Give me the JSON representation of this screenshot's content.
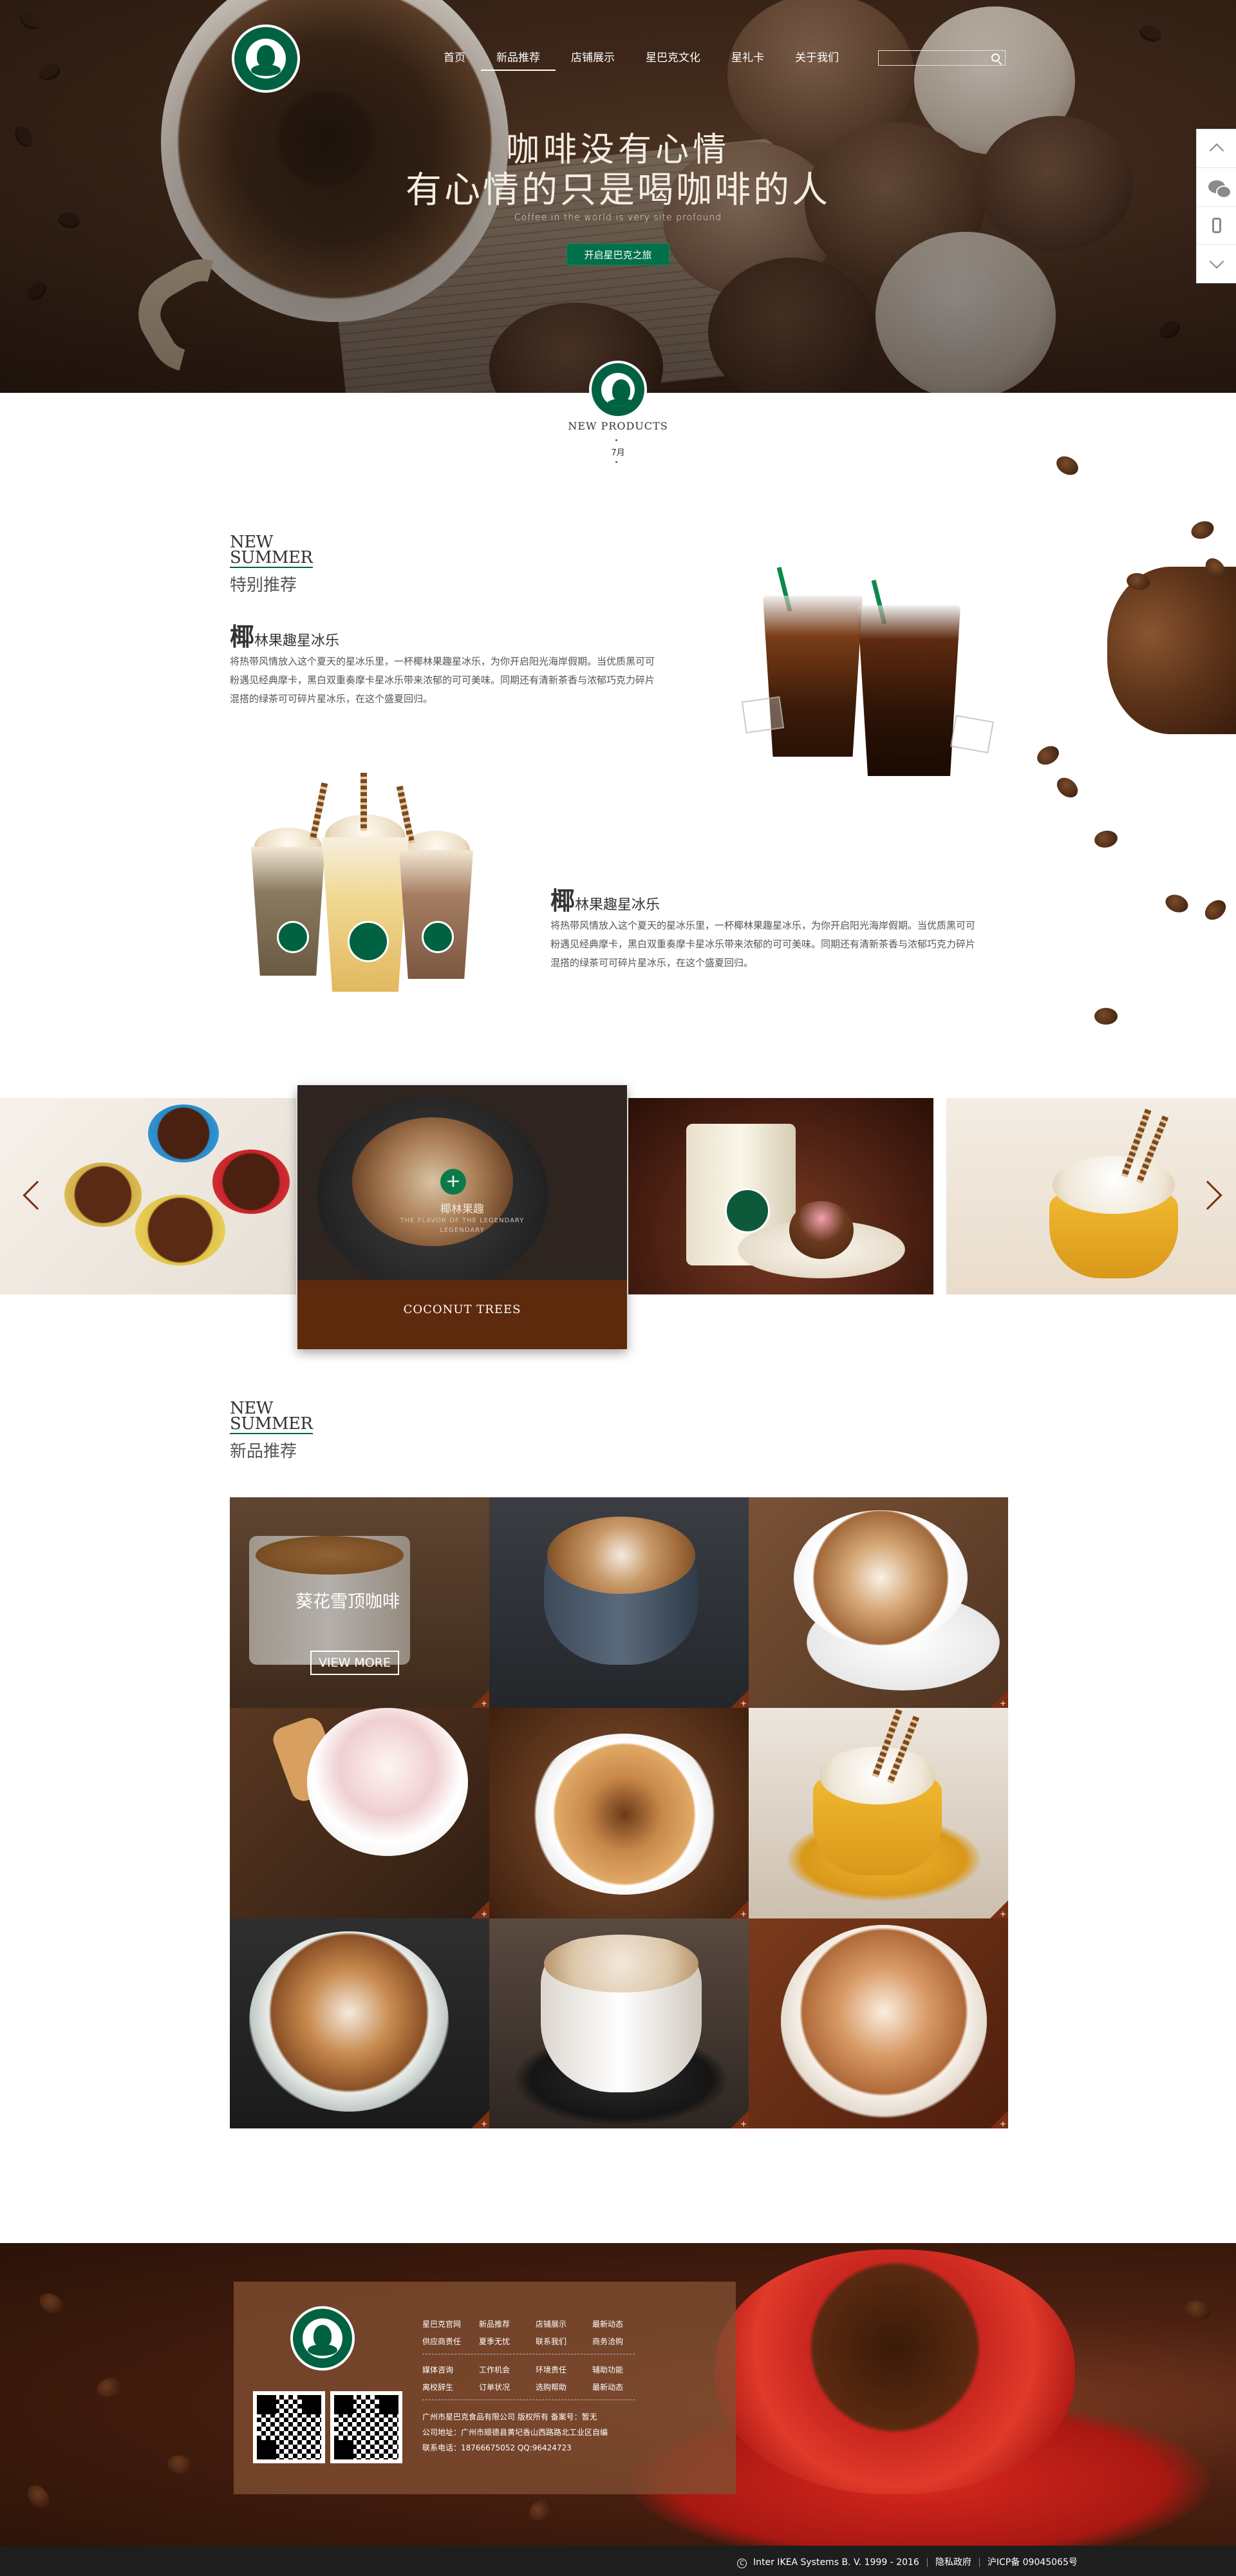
{
  "nav": {
    "items": [
      {
        "label": "首页",
        "active": false
      },
      {
        "label": "新品推荐",
        "active": true
      },
      {
        "label": "店铺展示",
        "active": false
      },
      {
        "label": "星巴克文化",
        "active": false
      },
      {
        "label": "星礼卡",
        "active": false
      },
      {
        "label": "关于我们",
        "active": false
      }
    ],
    "search_placeholder": ""
  },
  "hero": {
    "line1": "咖啡没有心情",
    "line2": "有心情的只是喝咖啡的人",
    "subtitle": "Coffee in the world is very site profound",
    "cta": "开启星巴克之旅"
  },
  "new_products": {
    "title": "NEW PRODUCTS",
    "month": "7月"
  },
  "special": {
    "en_line1": "NEW",
    "en_line2": "SUMMER",
    "cn": "特别推荐",
    "products": [
      {
        "big_char": "椰",
        "name": "林果趣星冰乐",
        "desc": "将热带风情放入这个夏天的星冰乐里，一杯椰林果趣星冰乐，为你开启阳光海岸假期。当优质黑可可粉遇见经典摩卡，黑白双重奏摩卡星冰乐带来浓郁的可可美味。同期还有清新茶香与浓郁巧克力碎片混搭的绿茶可可碎片星冰乐，在这个盛夏回归。"
      },
      {
        "big_char": "椰",
        "name": "林果趣星冰乐",
        "desc": "将热带风情放入这个夏天的星冰乐里，一杯椰林果趣星冰乐，为你开启阳光海岸假期。当优质黑可可粉遇见经典摩卡，黑白双重奏摩卡星冰乐带来浓郁的可可美味。同期还有清新茶香与浓郁巧克力碎片混搭的绿茶可可碎片星冰乐，在这个盛夏回归。"
      }
    ]
  },
  "carousel": {
    "active_caption_cn": "椰林果趣",
    "active_caption_en1": "THE FLAVOR OF THE LEGENDARY",
    "active_caption_en2": "LEGENDARY",
    "active_banner": "COCONUT TREES"
  },
  "new_rec": {
    "en_line1": "NEW",
    "en_line2": "SUMMER",
    "cn": "新品推荐",
    "featured_label": "葵花雪顶咖啡",
    "more_button": "VIEW MORE"
  },
  "footer": {
    "links": [
      "星巴克官网",
      "新品推荐",
      "店铺展示",
      "最新动态",
      "供应商责任",
      "夏季无忧",
      "联系我们",
      "商务洽购",
      "媒体咨询",
      "工作机会",
      "环境责任",
      "辅助功能",
      "离校辞生",
      "订单状况",
      "选购帮助",
      "最新动态"
    ],
    "company_line": "广州市星巴克食品有限公司   版权所有   备案号：暂无",
    "address_line": "公司地址：广州市顺德县黄圮香山西路路北工业区自编",
    "contact_line": "联系电话：18766675052      QQ:96424723"
  },
  "bottom_bar": {
    "copyright": "Inter  IKEA  Systems  B. V. 1999 - 2016",
    "privacy": "隐私政府",
    "icp": "沪ICP备  09045065号"
  }
}
